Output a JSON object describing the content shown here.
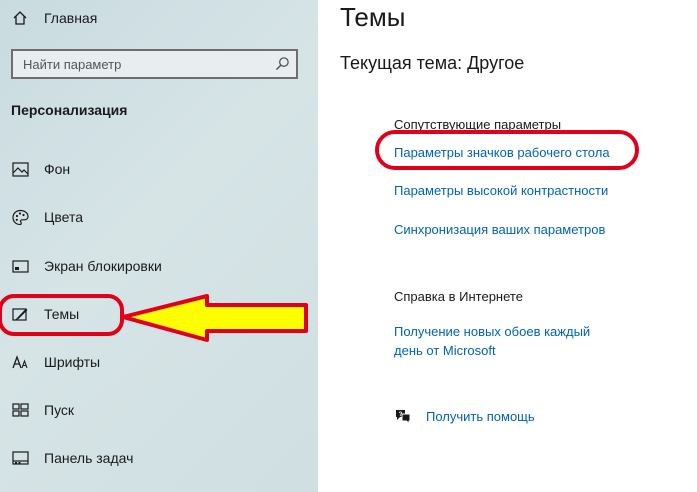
{
  "sidebar": {
    "home_label": "Главная",
    "search_placeholder": "Найти параметр",
    "section_title": "Персонализация",
    "items": [
      {
        "label": "Фон",
        "icon": "picture-icon"
      },
      {
        "label": "Цвета",
        "icon": "palette-icon"
      },
      {
        "label": "Экран блокировки",
        "icon": "lock-screen-icon"
      },
      {
        "label": "Темы",
        "icon": "themes-icon"
      },
      {
        "label": "Шрифты",
        "icon": "font-icon"
      },
      {
        "label": "Пуск",
        "icon": "start-icon"
      },
      {
        "label": "Панель задач",
        "icon": "taskbar-icon"
      }
    ]
  },
  "main": {
    "title": "Темы",
    "current_theme": "Текущая тема: Другое",
    "related": {
      "title": "Сопутствующие параметры",
      "links": [
        "Параметры значков рабочего стола",
        "Параметры высокой контрастности",
        "Синхронизация ваших параметров"
      ]
    },
    "web_help": {
      "title": "Справка в Интернете",
      "link_line1": "Получение новых обоев каждый",
      "link_line2": "день от Microsoft"
    },
    "get_help": "Получить помощь"
  },
  "colors": {
    "link": "#0063b1",
    "annotation_red": "#e0001b",
    "annotation_yellow": "#ffff00"
  }
}
